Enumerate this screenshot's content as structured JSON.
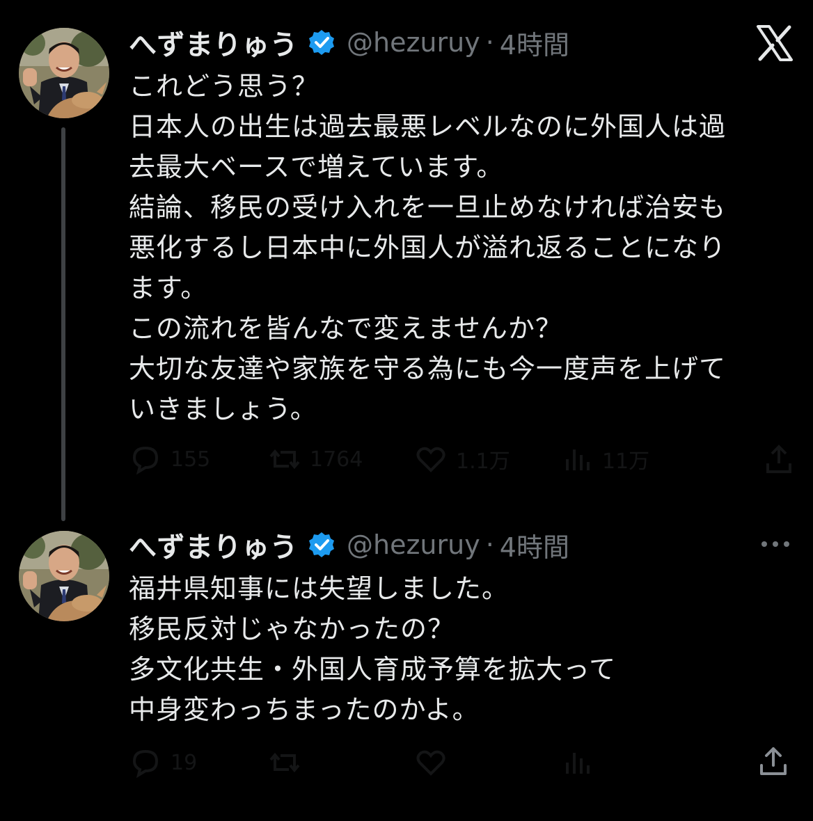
{
  "brand": {
    "logo_icon": "x-logo-icon",
    "background_color": "#000000",
    "text_color": "#e7e9ea",
    "secondary_color": "#71767b",
    "verified_color": "#1d9bf0"
  },
  "tweets": [
    {
      "author_name": "へずまりゅう",
      "handle": "@hezuruy",
      "separator": "·",
      "time": "4時間",
      "lines": [
        "これどう思う？",
        "日本人の出生は過去最悪レベルなのに外国人は過",
        "去最大ベースで増えています。",
        "結論、移民の受け入れを一旦止めなければ治安も",
        "悪化するし日本中に外国人が溢れ返ることになり",
        "ます。",
        "この流れを皆んなで変えませんか？",
        "大切な友達や家族を守る為にも今一度声を上げて",
        "いきましょう。"
      ],
      "actions": {
        "replies": "155",
        "reposts": "1764",
        "likes": "1.1万",
        "views": "11万"
      }
    },
    {
      "author_name": "へずまりゅう",
      "handle": "@hezuruy",
      "separator": "·",
      "time": "4時間",
      "lines": [
        "福井県知事には失望しました。",
        "移民反対じゃなかったの？",
        "多文化共生・外国人育成予算を拡大って",
        "中身変わっちまったのかよ。"
      ],
      "actions": {
        "replies": "19",
        "reposts": "",
        "likes": "",
        "views": ""
      }
    }
  ]
}
